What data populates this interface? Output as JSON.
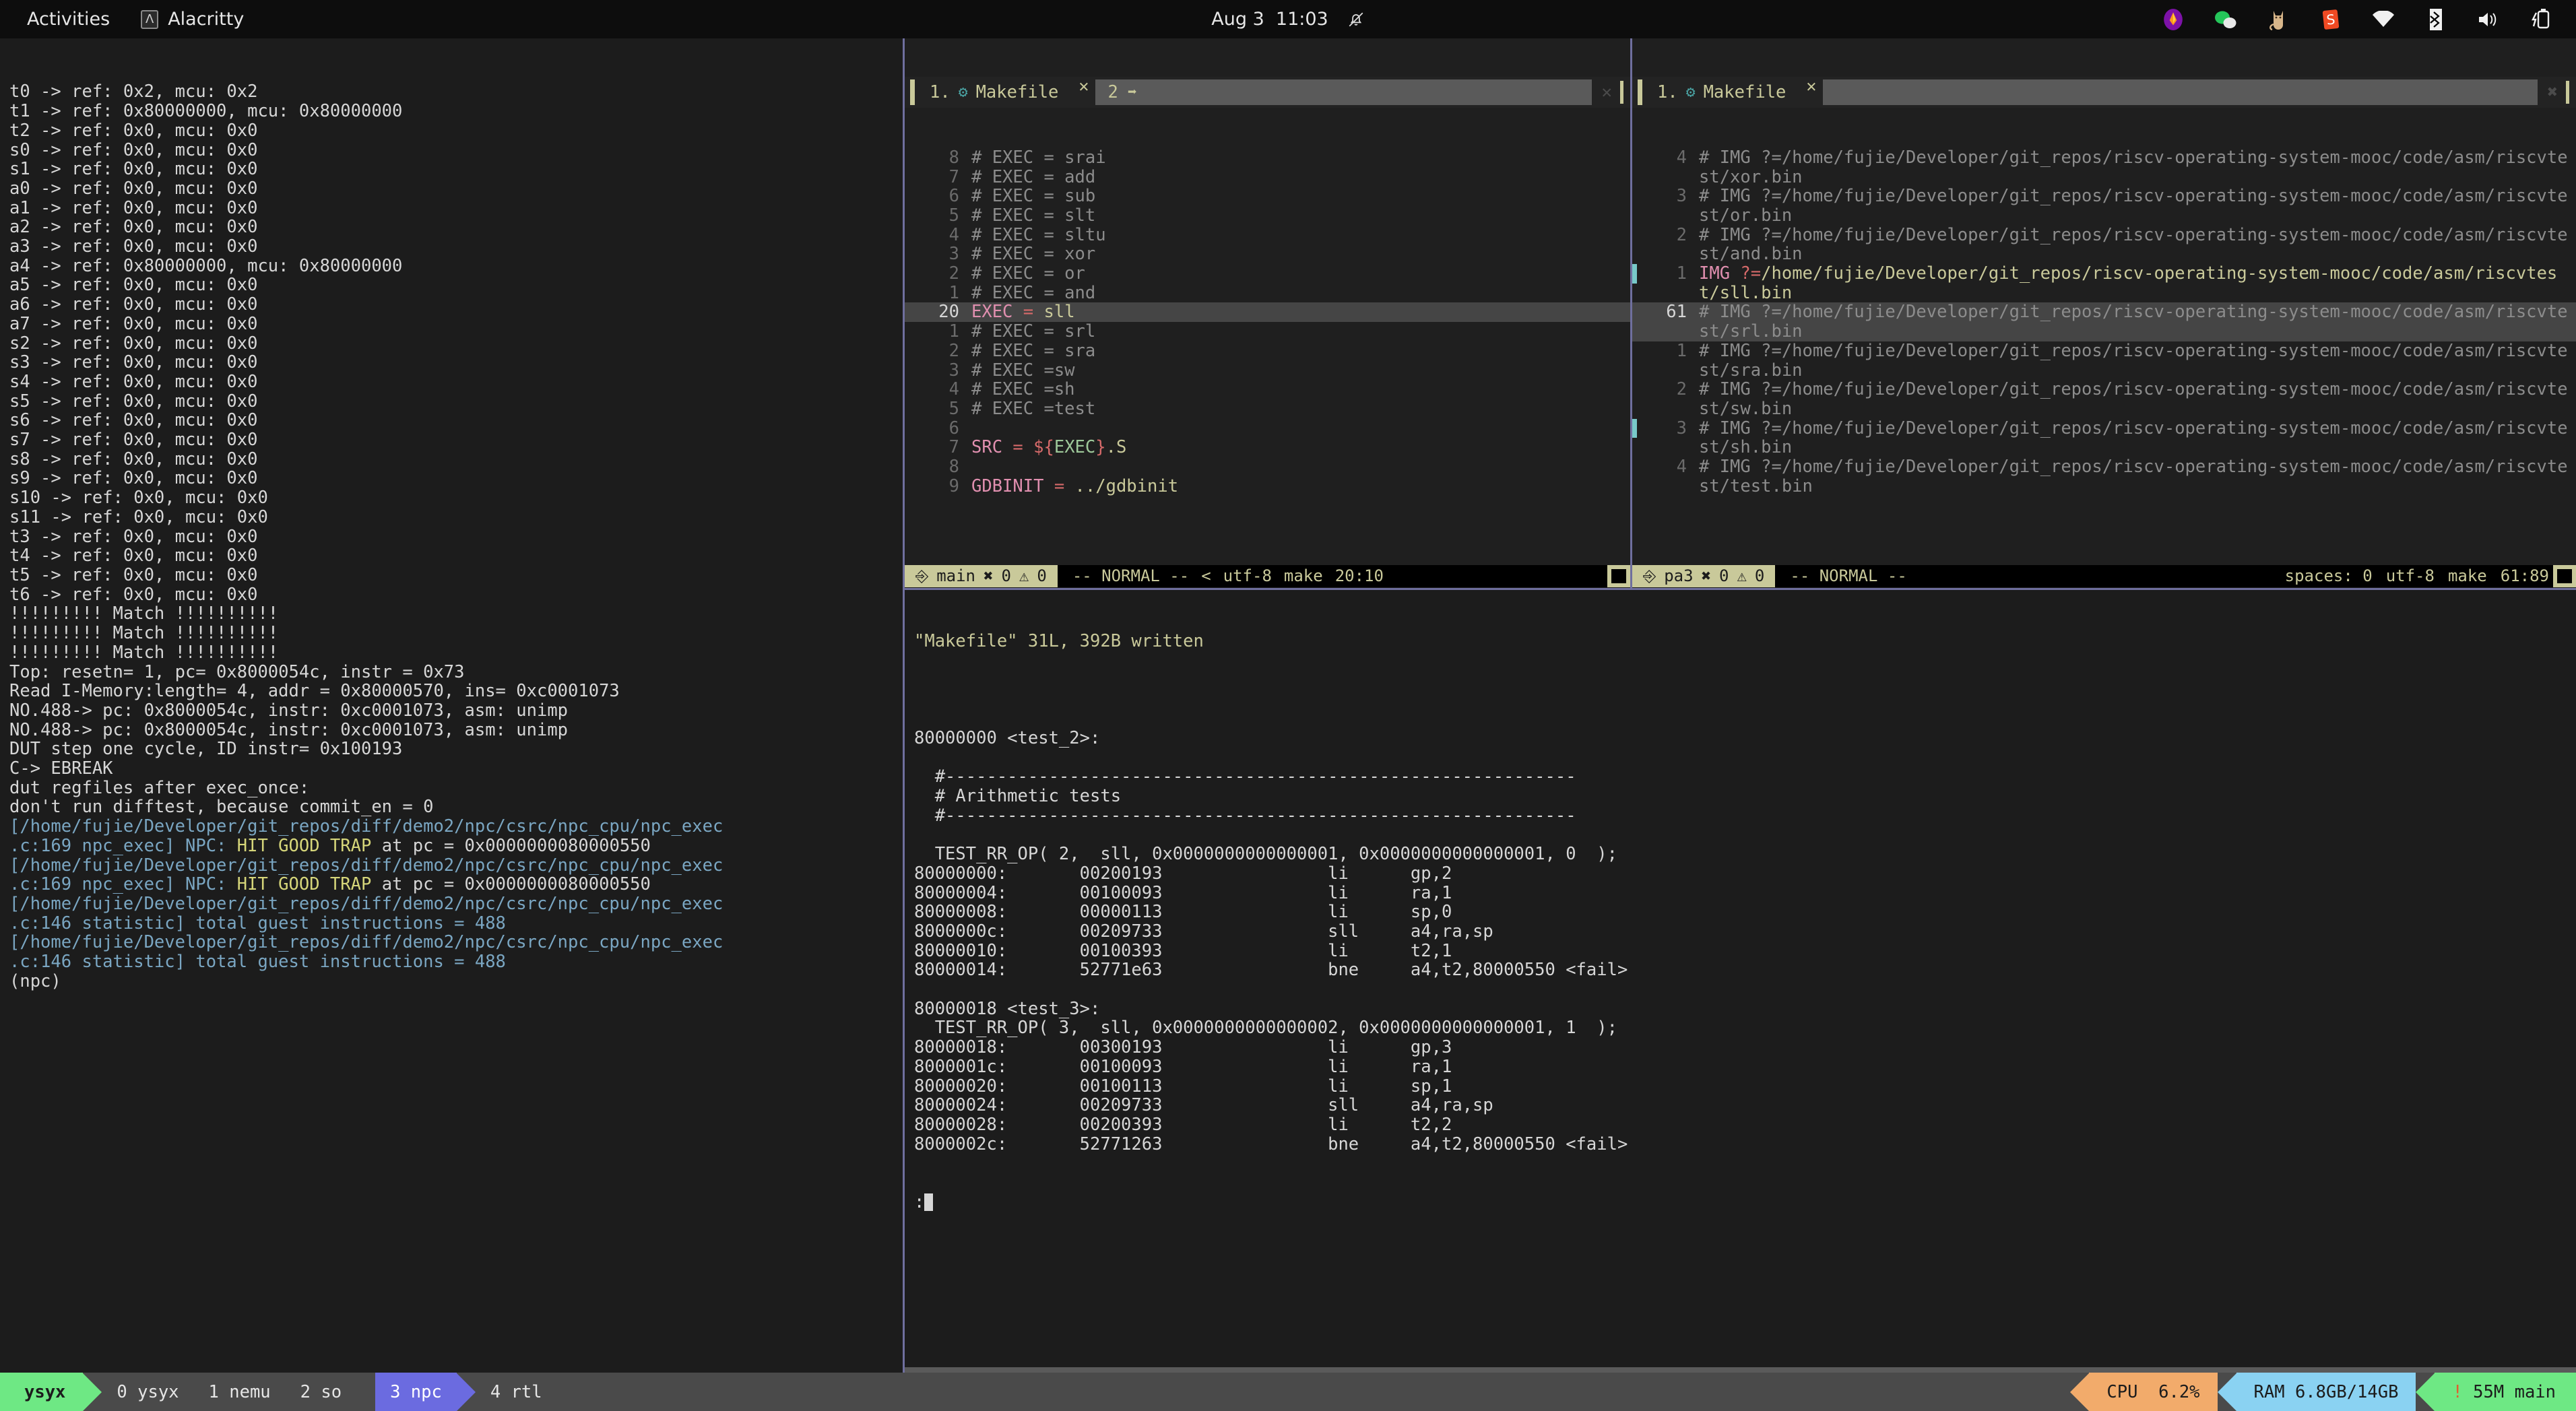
{
  "topbar": {
    "activities": "Activities",
    "app_name": "Alacritty",
    "app_icon": "alacritty-icon",
    "clock": "Aug 3  11:03",
    "bell_icon": "bell-muted-icon",
    "tray": [
      {
        "name": "firebase-icon",
        "glyph": "🔥"
      },
      {
        "name": "wechat-icon",
        "glyph": "💬"
      },
      {
        "name": "cat-app-icon",
        "glyph": "🐱"
      },
      {
        "name": "sogou-input-icon",
        "glyph": "S"
      },
      {
        "name": "wifi-icon",
        "glyph": "▼"
      },
      {
        "name": "bluetooth-icon",
        "glyph": "ᛦ"
      },
      {
        "name": "volume-icon",
        "glyph": "🔊"
      },
      {
        "name": "battery-charging-icon",
        "glyph": "🔋"
      }
    ]
  },
  "left_pane": {
    "name": "npc-diff-output",
    "lines": [
      {
        "text": "t0 -> ref: 0x2, mcu: 0x2",
        "color": "wht"
      },
      {
        "text": "t1 -> ref: 0x80000000, mcu: 0x80000000",
        "color": "wht"
      },
      {
        "text": "t2 -> ref: 0x0, mcu: 0x0",
        "color": "wht"
      },
      {
        "text": "s0 -> ref: 0x0, mcu: 0x0",
        "color": "wht"
      },
      {
        "text": "s1 -> ref: 0x0, mcu: 0x0",
        "color": "wht"
      },
      {
        "text": "a0 -> ref: 0x0, mcu: 0x0",
        "color": "wht"
      },
      {
        "text": "a1 -> ref: 0x0, mcu: 0x0",
        "color": "wht"
      },
      {
        "text": "a2 -> ref: 0x0, mcu: 0x0",
        "color": "wht"
      },
      {
        "text": "a3 -> ref: 0x0, mcu: 0x0",
        "color": "wht"
      },
      {
        "text": "a4 -> ref: 0x80000000, mcu: 0x80000000",
        "color": "wht"
      },
      {
        "text": "a5 -> ref: 0x0, mcu: 0x0",
        "color": "wht"
      },
      {
        "text": "a6 -> ref: 0x0, mcu: 0x0",
        "color": "wht"
      },
      {
        "text": "a7 -> ref: 0x0, mcu: 0x0",
        "color": "wht"
      },
      {
        "text": "s2 -> ref: 0x0, mcu: 0x0",
        "color": "wht"
      },
      {
        "text": "s3 -> ref: 0x0, mcu: 0x0",
        "color": "wht"
      },
      {
        "text": "s4 -> ref: 0x0, mcu: 0x0",
        "color": "wht"
      },
      {
        "text": "s5 -> ref: 0x0, mcu: 0x0",
        "color": "wht"
      },
      {
        "text": "s6 -> ref: 0x0, mcu: 0x0",
        "color": "wht"
      },
      {
        "text": "s7 -> ref: 0x0, mcu: 0x0",
        "color": "wht"
      },
      {
        "text": "s8 -> ref: 0x0, mcu: 0x0",
        "color": "wht"
      },
      {
        "text": "s9 -> ref: 0x0, mcu: 0x0",
        "color": "wht"
      },
      {
        "text": "s10 -> ref: 0x0, mcu: 0x0",
        "color": "wht"
      },
      {
        "text": "s11 -> ref: 0x0, mcu: 0x0",
        "color": "wht"
      },
      {
        "text": "t3 -> ref: 0x0, mcu: 0x0",
        "color": "wht"
      },
      {
        "text": "t4 -> ref: 0x0, mcu: 0x0",
        "color": "wht"
      },
      {
        "text": "t5 -> ref: 0x0, mcu: 0x0",
        "color": "wht"
      },
      {
        "text": "t6 -> ref: 0x0, mcu: 0x0",
        "color": "wht"
      },
      {
        "text": "!!!!!!!!! Match !!!!!!!!!!",
        "color": "wht"
      },
      {
        "text": "!!!!!!!!! Match !!!!!!!!!!",
        "color": "wht"
      },
      {
        "text": "!!!!!!!!! Match !!!!!!!!!!",
        "color": "wht"
      },
      {
        "text": "Top: resetn= 1, pc= 0x8000054c, instr = 0x73",
        "color": "wht"
      },
      {
        "text": "Read I-Memory:length= 4, addr = 0x80000570, ins= 0xc0001073",
        "color": "wht"
      },
      {
        "text": "NO.488-> pc: 0x8000054c, instr: 0xc0001073, asm: unimp",
        "color": "wht"
      },
      {
        "text": "NO.488-> pc: 0x8000054c, instr: 0xc0001073, asm: unimp",
        "color": "wht"
      },
      {
        "text": "DUT step one cycle, ID instr= 0x100193",
        "color": "wht"
      },
      {
        "text": "C-> EBREAK",
        "color": "wht"
      },
      {
        "text": "dut regfiles after exec_once:",
        "color": "wht"
      },
      {
        "text": "don't run difftest, because commit_en = 0",
        "color": "wht"
      },
      {
        "text": "[/home/fujie/Developer/git_repos/diff/demo2/npc/csrc/npc_cpu/npc_exec",
        "color": "blue"
      },
      {
        "text": ".c:169 npc_exec] NPC: ",
        "color": "blue",
        "suffix_yel": "HIT GOOD TRAP",
        "suffix_wht": " at pc = 0x0000000080000550"
      },
      {
        "text": "[/home/fujie/Developer/git_repos/diff/demo2/npc/csrc/npc_cpu/npc_exec",
        "color": "blue"
      },
      {
        "text": ".c:169 npc_exec] NPC: ",
        "color": "blue",
        "suffix_yel": "HIT GOOD TRAP",
        "suffix_wht": " at pc = 0x0000000080000550"
      },
      {
        "text": "[/home/fujie/Developer/git_repos/diff/demo2/npc/csrc/npc_cpu/npc_exec",
        "color": "blue"
      },
      {
        "text": ".c:146 statistic] total guest instructions = 488",
        "color": "blue"
      },
      {
        "text": "[/home/fujie/Developer/git_repos/diff/demo2/npc/csrc/npc_cpu/npc_exec",
        "color": "blue"
      },
      {
        "text": ".c:146 statistic] total guest instructions = 488",
        "color": "blue"
      },
      {
        "text": "(npc)",
        "color": "wht"
      }
    ]
  },
  "mid_editor": {
    "name": "makefile-editor-left",
    "tabs": [
      {
        "index": "1.",
        "icon": "gear-icon",
        "label": "Makefile",
        "close": "✕"
      },
      {
        "index": "2",
        "icon": "arrow-right-circle-icon",
        "label": "",
        "close": "✕"
      }
    ],
    "lines": [
      {
        "num": "8",
        "text": "# EXEC = srai"
      },
      {
        "num": "7",
        "text": "# EXEC = add"
      },
      {
        "num": "6",
        "text": "# EXEC = sub"
      },
      {
        "num": "5",
        "text": "# EXEC = slt"
      },
      {
        "num": "4",
        "text": "# EXEC = sltu"
      },
      {
        "num": "3",
        "text": "# EXEC = xor"
      },
      {
        "num": "2",
        "text": "# EXEC = or"
      },
      {
        "num": "1",
        "text": "# EXEC = and"
      },
      {
        "num": "20",
        "text": "EXEC = sll",
        "current": true,
        "parts": [
          {
            "t": "EXEC",
            "c": "var"
          },
          {
            "t": " = ",
            "c": "op"
          },
          {
            "t": "sll",
            "c": "str"
          }
        ]
      },
      {
        "num": "1",
        "text": "# EXEC = srl"
      },
      {
        "num": "2",
        "text": "# EXEC = sra"
      },
      {
        "num": "3",
        "text": "# EXEC =sw"
      },
      {
        "num": "4",
        "text": "# EXEC =sh"
      },
      {
        "num": "5",
        "text": "# EXEC =test"
      },
      {
        "num": "6",
        "text": ""
      },
      {
        "num": "7",
        "text": "SRC = ${EXEC}.S",
        "parts": [
          {
            "t": "SRC",
            "c": "var"
          },
          {
            "t": " = ",
            "c": "op"
          },
          {
            "t": "${",
            "c": "op"
          },
          {
            "t": "EXEC",
            "c": "grn"
          },
          {
            "t": "}",
            "c": "op"
          },
          {
            "t": ".S",
            "c": "str"
          }
        ]
      },
      {
        "num": "8",
        "text": ""
      },
      {
        "num": "9",
        "text": "GDBINIT = ../gdbinit",
        "parts": [
          {
            "t": "GDBINIT",
            "c": "var"
          },
          {
            "t": " = ",
            "c": "op"
          },
          {
            "t": "../gdbinit",
            "c": "str"
          }
        ]
      }
    ],
    "status": {
      "branch_icon": "git-branch-icon",
      "branch": "main",
      "error_icon": "error-icon",
      "errors": "0",
      "warn_icon": "warning-icon",
      "warnings": "0",
      "mode": "-- NORMAL --",
      "scroll": "<",
      "encoding": "utf-8",
      "filetype": "make",
      "position": "20:10"
    }
  },
  "right_editor": {
    "name": "makefile-editor-right",
    "tabs": [
      {
        "index": "1.",
        "icon": "gear-icon",
        "label": "Makefile",
        "close": "✕"
      }
    ],
    "lines": [
      {
        "num": "4",
        "text": "# IMG ?=/home/fujie/Developer/git_repos/riscv-operating-system-mooc/code/asm/riscvtest/xor.bin"
      },
      {
        "num": "3",
        "text": "# IMG ?=/home/fujie/Developer/git_repos/riscv-operating-system-mooc/code/asm/riscvtest/or.bin"
      },
      {
        "num": "2",
        "text": "# IMG ?=/home/fujie/Developer/git_repos/riscv-operating-system-mooc/code/asm/riscvtest/and.bin"
      },
      {
        "num": "1",
        "text": "IMG ?=/home/fujie/Developer/git_repos/riscv-operating-system-mooc/code/asm/riscvtest/sll.bin",
        "mark": true,
        "parts": [
          {
            "t": "IMG ",
            "c": "var"
          },
          {
            "t": "?=",
            "c": "op"
          },
          {
            "t": "/home/fujie/Developer/git_repos/riscv-operating-system-mooc/code/asm/riscvtest/sll.bin",
            "c": "str"
          }
        ]
      },
      {
        "num": "61",
        "text": "# IMG ?=/home/fujie/Developer/git_repos/riscv-operating-system-mooc/code/asm/riscvtest/srl.bin",
        "current": true
      },
      {
        "num": "1",
        "text": "# IMG ?=/home/fujie/Developer/git_repos/riscv-operating-system-mooc/code/asm/riscvtest/sra.bin"
      },
      {
        "num": "2",
        "text": "# IMG ?=/home/fujie/Developer/git_repos/riscv-operating-system-mooc/code/asm/riscvtest/sw.bin"
      },
      {
        "num": "3",
        "text": "# IMG ?=/home/fujie/Developer/git_repos/riscv-operating-system-mooc/code/asm/riscvtest/sh.bin",
        "mark": true
      },
      {
        "num": "4",
        "text": "# IMG ?=/home/fujie/Developer/git_repos/riscv-operating-system-mooc/code/asm/riscvtest/test.bin"
      }
    ],
    "status": {
      "branch_icon": "git-branch-icon",
      "branch": "pa3",
      "error_icon": "error-icon",
      "errors": "0",
      "warn_icon": "warning-icon",
      "warnings": "0",
      "mode": "-- NORMAL --",
      "spaces": "spaces: 0",
      "encoding": "utf-8",
      "filetype": "make",
      "position": "61:89"
    }
  },
  "bottom_pane": {
    "name": "objdump-output",
    "write_msg": "\"Makefile\" 31L, 392B written",
    "lines": [
      {
        "text": ""
      },
      {
        "text": ""
      },
      {
        "text": "80000000 <test_2>:"
      },
      {
        "text": ""
      },
      {
        "text": "  #-------------------------------------------------------------"
      },
      {
        "text": "  # Arithmetic tests"
      },
      {
        "text": "  #-------------------------------------------------------------"
      },
      {
        "text": ""
      },
      {
        "text": "  TEST_RR_OP( 2,  sll, 0x0000000000000001, 0x0000000000000001, 0  );"
      },
      {
        "text": "80000000:       00200193                li      gp,2"
      },
      {
        "text": "80000004:       00100093                li      ra,1"
      },
      {
        "text": "80000008:       00000113                li      sp,0"
      },
      {
        "text": "8000000c:       00209733                sll     a4,ra,sp"
      },
      {
        "text": "80000010:       00100393                li      t2,1"
      },
      {
        "text": "80000014:       52771e63                bne     a4,t2,80000550 <fail>"
      },
      {
        "text": ""
      },
      {
        "text": "80000018 <test_3>:"
      },
      {
        "text": "  TEST_RR_OP( 3,  sll, 0x0000000000000002, 0x0000000000000001, 1  );"
      },
      {
        "text": "80000018:       00300193                li      gp,3"
      },
      {
        "text": "8000001c:       00100093                li      ra,1"
      },
      {
        "text": "80000020:       00100113                li      sp,1"
      },
      {
        "text": "80000024:       00209733                sll     a4,ra,sp"
      },
      {
        "text": "80000028:       00200393                li      t2,2"
      },
      {
        "text": "8000002c:       52771263                bne     a4,t2,80000550 <fail>"
      },
      {
        "text": ""
      },
      {
        "text": ""
      },
      {
        "text": ":"
      }
    ]
  },
  "tmux": {
    "session": "ysyx",
    "windows": [
      {
        "label": "0 ysyx",
        "active": false
      },
      {
        "label": "1 nemu",
        "active": false
      },
      {
        "label": "2 so",
        "active": false
      },
      {
        "label": "3 npc",
        "active": true
      },
      {
        "label": "4 rtl",
        "active": false
      }
    ],
    "cpu": "CPU  6.2%",
    "ram": "RAM 6.8GB/14GB",
    "git": "! 55M main",
    "git_bang": "!",
    "git_rest": " 55M main"
  },
  "colors": {
    "bg": "#1c1c1c",
    "editor_bg": "#1f1f1f",
    "accent_status": "#c9c99a",
    "tmux_session": "#6ee884",
    "tmux_active_window": "#6b6be0",
    "tmux_cpu": "#f2ab6b",
    "tmux_ram": "#8ad2f2",
    "log_blue": "#7aa6c2",
    "trap_yellow": "#d6d67a",
    "split_line": "#6f6f9e"
  }
}
